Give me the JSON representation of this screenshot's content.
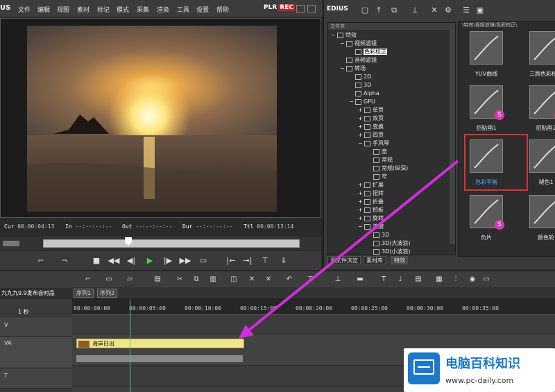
{
  "app": {
    "logo": "US"
  },
  "menu": [
    "文件",
    "编辑",
    "视图",
    "素材",
    "标记",
    "模式",
    "采集",
    "渲染",
    "工具",
    "设置",
    "帮助"
  ],
  "player": {
    "plr_label": "PLR",
    "rec_label": "REC"
  },
  "timecodes": {
    "cur_label": "Cur",
    "cur": "00:00:04:13",
    "in_label": "In",
    "in": "--:--:--:--",
    "out_label": "Out",
    "out": "--:--:--:--",
    "dur_label": "Dur",
    "dur": "--:--:--:--",
    "ttl_label": "Ttl",
    "ttl": "00:00:13:14"
  },
  "right_panel": {
    "title": "EDIUS",
    "tree_header": "文件夹",
    "path": "\\特效\\视频滤镜\\色彩校正\\",
    "tree": [
      {
        "label": "特效",
        "level": 0,
        "expander": "−"
      },
      {
        "label": "视频滤镜",
        "level": 1,
        "expander": "−"
      },
      {
        "label": "色彩校正",
        "level": 2,
        "expander": "",
        "selected": true
      },
      {
        "label": "音频滤镜",
        "level": 1,
        "expander": ""
      },
      {
        "label": "转场",
        "level": 1,
        "expander": "−"
      },
      {
        "label": "2D",
        "level": 2,
        "expander": ""
      },
      {
        "label": "3D",
        "level": 2,
        "expander": ""
      },
      {
        "label": "Alpha",
        "level": 2,
        "expander": ""
      },
      {
        "label": "GPU",
        "level": 2,
        "expander": "−"
      },
      {
        "label": "单页",
        "level": 3,
        "expander": "+"
      },
      {
        "label": "双页",
        "level": 3,
        "expander": "+"
      },
      {
        "label": "变换",
        "level": 3,
        "expander": "+"
      },
      {
        "label": "四页",
        "level": 3,
        "expander": "+"
      },
      {
        "label": "手风琴",
        "level": 3,
        "expander": "−"
      },
      {
        "label": "宽",
        "level": 4,
        "expander": ""
      },
      {
        "label": "常规",
        "level": 4,
        "expander": ""
      },
      {
        "label": "常规(纵深)",
        "level": 4,
        "expander": ""
      },
      {
        "label": "窄",
        "level": 4,
        "expander": ""
      },
      {
        "label": "扩展",
        "level": 3,
        "expander": "+"
      },
      {
        "label": "扭转",
        "level": 3,
        "expander": "+"
      },
      {
        "label": "折叠",
        "level": 3,
        "expander": "+"
      },
      {
        "label": "拍板",
        "level": 3,
        "expander": "+"
      },
      {
        "label": "旋转",
        "level": 3,
        "expander": "+"
      },
      {
        "label": "涟漪",
        "level": 3,
        "expander": "−"
      },
      {
        "label": "3D",
        "level": 4,
        "expander": ""
      },
      {
        "label": "3D(大波浪)",
        "level": 4,
        "expander": ""
      },
      {
        "label": "3D(小波浪)",
        "level": 4,
        "expander": ""
      }
    ],
    "tabs": [
      "源文件浏览",
      "素材库",
      "特效"
    ],
    "effects": [
      {
        "label": "YUV曲线",
        "badge": ""
      },
      {
        "label": "三路色彩校正",
        "badge": ""
      },
      {
        "label": "招贴画1",
        "badge": "S"
      },
      {
        "label": "招贴画2",
        "badge": "S"
      },
      {
        "label": "色彩平衡",
        "badge": ""
      },
      {
        "label": "褪色1",
        "badge": ""
      },
      {
        "label": "负片",
        "badge": "S"
      },
      {
        "label": "颜色轮",
        "badge": ""
      }
    ],
    "highlight_color": "#d83333"
  },
  "timeline": {
    "project": "九九九9.9发布会时品",
    "scale": "1 秒",
    "sequences": [
      "序列1",
      "序列2"
    ],
    "ruler": [
      "00:00:00:00",
      "00:00:05:00",
      "00:00:10:00",
      "00:00:15:00",
      "00:00:20:00",
      "00:00:25:00",
      "00:00:30:00",
      "00:00:35:00"
    ],
    "tracks": [
      {
        "name": "V"
      },
      {
        "name": "VA"
      },
      {
        "name": "T"
      }
    ],
    "clip_label": "海岸日出"
  },
  "watermark": {
    "title": "电脑百科知识",
    "url": "www.pc-daily.com",
    "title_color": "#1a77c8"
  },
  "arrow_color": "#d02ddb"
}
